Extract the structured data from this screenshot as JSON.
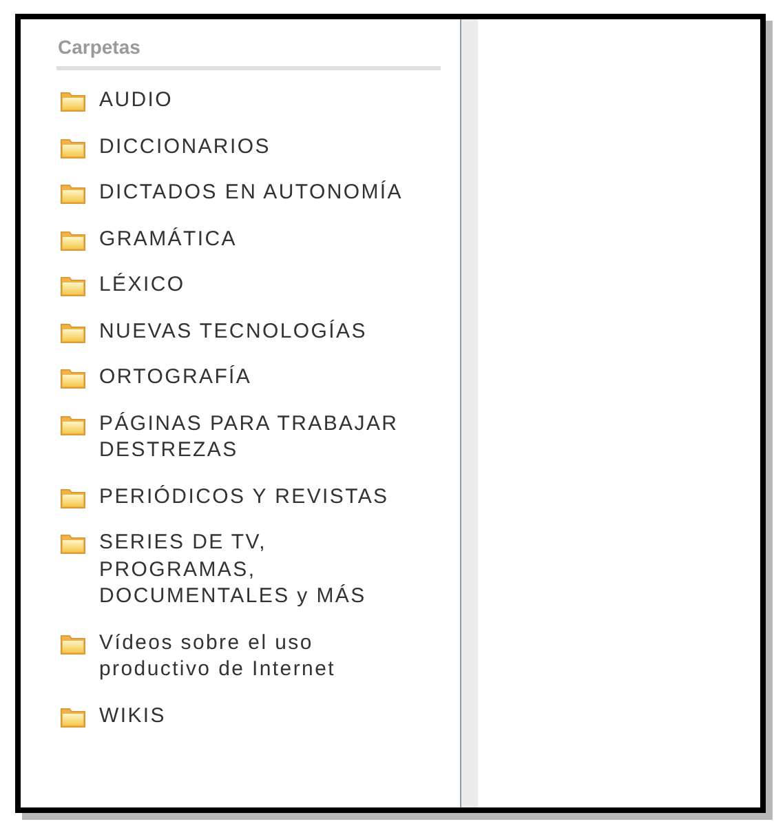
{
  "sidebar": {
    "title": "Carpetas",
    "items": [
      {
        "label": "AUDIO"
      },
      {
        "label": "DICCIONARIOS"
      },
      {
        "label": "DICTADOS EN AUTONOMÍA"
      },
      {
        "label": "GRAMÁTICA"
      },
      {
        "label": "LÉXICO"
      },
      {
        "label": "NUEVAS TECNOLOGÍAS"
      },
      {
        "label": "ORTOGRAFÍA"
      },
      {
        "label": "PÁGINAS PARA TRABAJAR DESTREZAS"
      },
      {
        "label": "PERIÓDICOS Y REVISTAS"
      },
      {
        "label": "SERIES DE TV, PROGRAMAS, DOCUMENTALES y MÁS"
      },
      {
        "label": "Vídeos sobre el uso productivo de Internet"
      },
      {
        "label": "WIKIS"
      }
    ]
  }
}
